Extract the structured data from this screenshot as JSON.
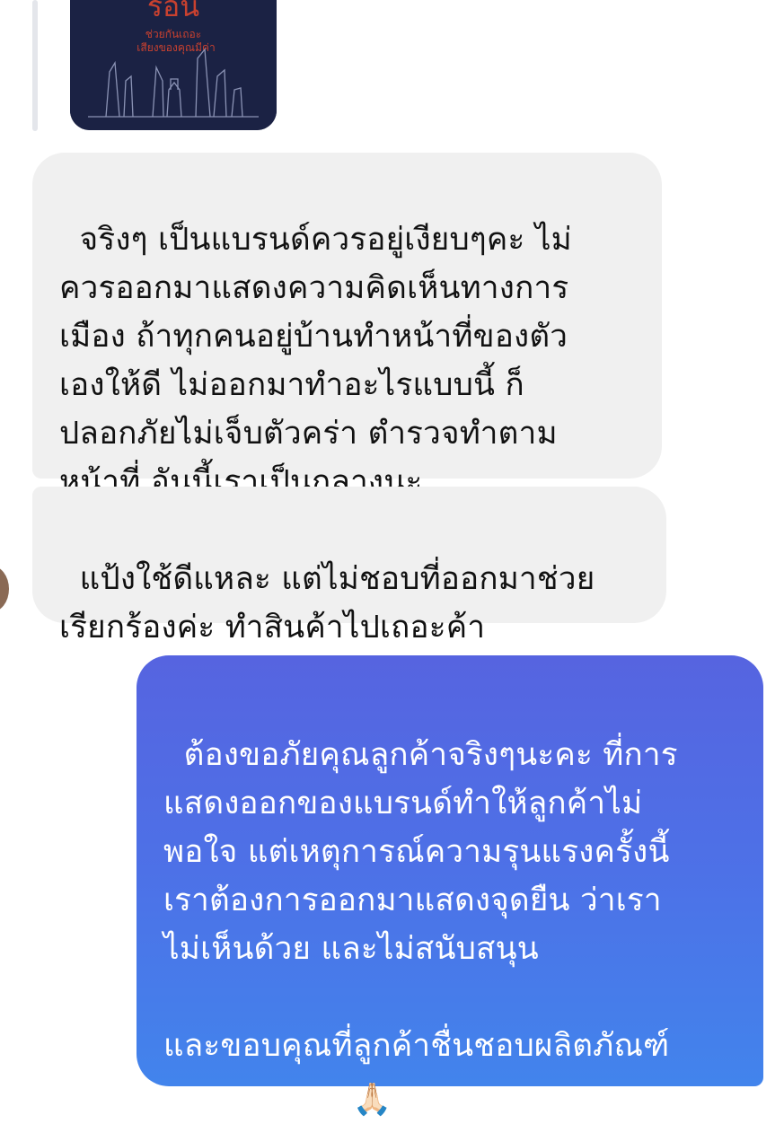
{
  "thread": {
    "shared_image": {
      "title": "ร้อน",
      "subtitle_line1": "ช่วยกันเถอะ",
      "subtitle_line2": "เสียงของคุณมีค่า"
    },
    "messages": [
      {
        "sender": "customer",
        "text": "จริงๆ เป็นแบรนด์ควรอยู่เงียบๆคะ ไม่\nควรออกมาแสดงความคิดเห็นทางการ\nเมือง ถ้าทุกคนอยู่บ้านทำหน้าที่ของตัว\nเองให้ดี ไม่ออกมาทำอะไรแบบนี้ ก็\nปลอกภัยไม่เจ็บตัวคร่า ตำรวจทำตาม\nหน้าที่ อันนี้เราเป็นกลางนะ"
      },
      {
        "sender": "customer",
        "text": "แป้งใช้ดีแหละ แต่ไม่ชอบที่ออกมาช่วย\nเรียกร้องค่ะ ทำสินค้าไปเถอะค้า"
      },
      {
        "sender": "brand",
        "text": "ต้องขอภัยคุณลูกค้าจริงๆนะคะ ที่การ\nแสดงออกของแบรนด์ทำให้ลูกค้าไม่\nพอใจ แต่เหตุการณ์ความรุนแรงครั้งนี้\nเราต้องการออกมาแสดงจุดยืน ว่าเรา\nไม่เห็นด้วย และไม่สนับสนุน\n\nและขอบคุณที่ลูกค้าชื่นชอบผลิตภัณฑ์\nของเรานะคะ ",
        "emoji": "🙏🏻",
        "emoji_name": "folded-hands"
      }
    ]
  },
  "colors": {
    "incoming_bubble": "#f0f0f0",
    "outgoing_gradient_top": "#5664e0",
    "outgoing_gradient_bottom": "#4284ec"
  }
}
